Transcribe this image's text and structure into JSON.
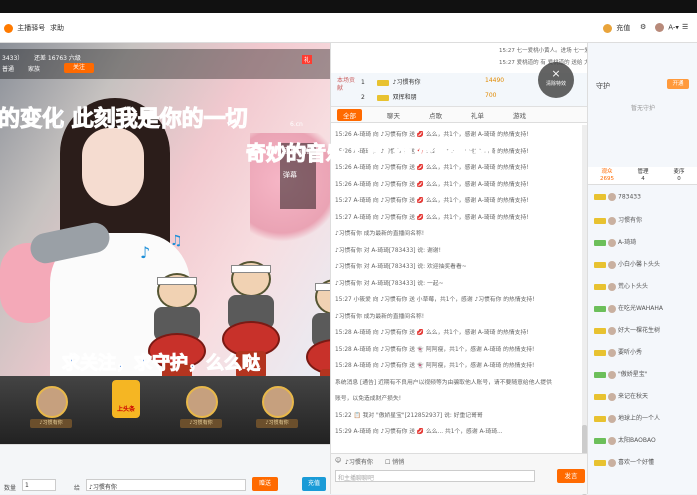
{
  "topbar": {
    "logo_text": "主播驿号",
    "help": "求助",
    "recharge": "充值"
  },
  "video": {
    "room_id_partial": "3433）",
    "subscribe_text": "还差 16763 六级",
    "vip_text": "普通",
    "fans_text": "家族",
    "follow_btn": "关注",
    "lyric_1": "的变化  此刻我是你的一切",
    "lyric_2": "奇妙的音乐  口红绝对要鲜艳",
    "lyric_bottom": "求关注，求守护，么么哒",
    "music_badge_1": "直播排报",
    "music_badge_2": "弹幕",
    "cc_label": "6.cn",
    "gift_labels": [
      "♪习惯有你",
      "♪习惯有你",
      "♪习惯有你"
    ],
    "gift_top_label": "上头条",
    "bottom_qty_label": "数量",
    "bottom_qty_value": "1",
    "bottom_to_label": "给",
    "bottom_to_value": "♪习惯有你",
    "send_btn": "赠送",
    "more_btn": "充值"
  },
  "middle": {
    "sys_msgs": [
      "15:27 七一爱桃小黄人。进场 七一爱桃。1个游艇",
      "15:27 爱桃道的 有 爱桃道的 送给 大富 ✕ 666个上头条"
    ],
    "ranking_label": "本场贡献",
    "ranking": [
      {
        "rank": "1",
        "name": "♪习惯有你",
        "value": "14490"
      },
      {
        "rank": "2",
        "name": "双挥和朋",
        "value": "700"
      }
    ],
    "tabs": [
      "全部",
      "聊天",
      "点歌",
      "礼单",
      "游戏"
    ],
    "chat": [
      "15:26 A-琦琦 向 ♪习惯有你 送 💋 么么，共1个，感谢 A-琦琦 的热情支持!",
      "15:26 A-琦琦 向 ♪习惯有你 送 💋 么么，共1个，感谢 A-琦琦 的热情支持!",
      "15:26 A-琦琦 向 ♪习惯有你 送 💋 么么，共1个，感谢 A-琦琦 的热情支持!",
      "15:26 A-琦琦 向 ♪习惯有你 送 💋 么么，共1个，感谢 A-琦琦 的热情支持!",
      "15:27 A-琦琦 向 ♪习惯有你 送 💋 么么，共1个，感谢 A-琦琦 的热情支持!",
      "15:27 A-琦琦 向 ♪习惯有你 送 💋 么么，共1个，感谢 A-琦琦 的热情支持!",
      "♪习惯有你 成为最新的直播间名称!",
      "♪习惯有你 对 A-琦琦[783433] 说: 谢谢!",
      "♪习惯有你 对 A-琦琦[783433] 说: 欢迎抽奖看看~",
      "♪习惯有你 对 A-琦琦[783433] 说: 一起~",
      "15:27 小筱爱 向 ♪习惯有你 送 小草莓，共1个，感谢 ♪习惯有你 的热情支持!",
      "♪习惯有你 成为最新的直播间名称!",
      "15:28 A-琦琦 向 ♪习惯有你 送 💋 么么，共1个，感谢 A-琦琦 的热情支持!",
      "15:28 A-琦琦 向 ♪习惯有你 送 👻 阿阿瘦，共1个，感谢 A-琦琦 的热情支持!",
      "15:28 A-琦琦 向 ♪习惯有你 送 👻 阿阿瘦，共1个，感谢 A-琦琦 的热情支持!",
      "系统消息 [通告] 近期有不良用户以视频等为由骗取他人账号，请不要随意给他人提供",
      "账号，以免造成财产损失!",
      "15:22 📋 我对 \"傲娇星宝\"[212852937] 说: 好重记哥哥",
      "15:29 A-琦琦 向 ♪习惯有你 送 💋 么么... 共1个，感谢 A-琦琦..."
    ],
    "input_tool_target": "♪习惯有你",
    "input_tool_private": "悄悄",
    "input_placeholder": "和主播聊聊吧",
    "send_btn": "发言",
    "close_label": "清除特效"
  },
  "right": {
    "guard_title": "守护",
    "guard_open": "开通",
    "guard_empty": "暂无守护",
    "tabs": [
      {
        "label": "观众",
        "count": "2695"
      },
      {
        "label": "管理",
        "count": "4"
      },
      {
        "label": "麦序",
        "count": "0"
      }
    ],
    "viewers": [
      "783433",
      "习惯有你",
      "A-琦琦",
      "小白小馨卜头头",
      "荒心卜头头",
      "在吃光WAHAHA",
      "好大一棵花生树",
      "要听小秀",
      "\"傲娇星宝\"",
      "来记在秋天",
      "地球上的一个人",
      "太阳BAOBAO",
      "喜欢一个好懂"
    ]
  }
}
